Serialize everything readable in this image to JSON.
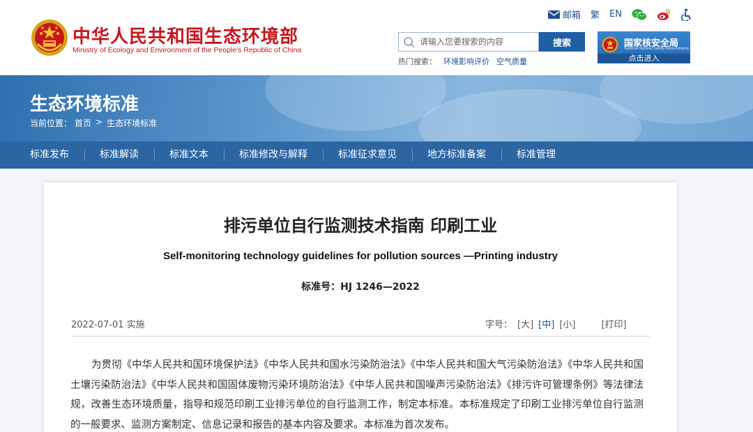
{
  "header": {
    "site_title": "中华人民共和国生态环境部",
    "site_subtitle": "Ministry of Ecology and Environment of the People's Republic of China",
    "toplinks": {
      "mail": "邮箱",
      "traditional": "繁",
      "english": "EN"
    },
    "search": {
      "placeholder": "请输入您要搜索的内容",
      "button": "搜索"
    },
    "hot": {
      "label": "热门搜索：",
      "items": [
        "环境影响评价",
        "空气质量"
      ]
    },
    "nnsa": {
      "name": "国家核安全局",
      "english": "National Nuclear Safety Administration",
      "enter": "点击进入"
    }
  },
  "banner": {
    "title": "生态环境标准",
    "breadcrumb": {
      "label": "当前位置：",
      "home": "首页",
      "separator": ">",
      "current": "生态环境标准"
    }
  },
  "nav": {
    "items": [
      "标准发布",
      "标准解读",
      "标准文本",
      "标准修改与解释",
      "标准征求意见",
      "地方标准备案",
      "标准管理"
    ]
  },
  "article": {
    "title": "排污单位自行监测技术指南 印刷工业",
    "title_en": "Self-monitoring technology guidelines for pollution sources —Printing industry",
    "code": "标准号：HJ 1246—2022",
    "date": "2022-07-01 实施",
    "font_label": "字号：",
    "font_large": "[大]",
    "font_medium": "[中]",
    "font_small": "[小]",
    "print": "[打印]",
    "body": "为贯彻《中华人民共和国环境保护法》《中华人民共和国水污染防治法》《中华人民共和国大气污染防治法》《中华人民共和国土壤污染防治法》《中华人民共和国固体废物污染环境防治法》《中华人民共和国噪声污染防治法》《排污许可管理条例》等法律法规，改善生态环境质量，指导和规范印刷工业排污单位的自行监测工作，制定本标准。本标准规定了印刷工业排污单位自行监测的一般要求、监测方案制定、信息记录和报告的基本内容及要求。本标准为首次发布。"
  },
  "colors": {
    "brand_red": "#c8161d",
    "nav_blue": "#2b66a3",
    "link_blue": "#1f4f8f"
  },
  "icons": [
    "national-emblem-icon",
    "mail-icon",
    "wechat-icon",
    "weibo-icon",
    "accessibility-icon",
    "search-icon",
    "nnsa-badge-icon"
  ]
}
